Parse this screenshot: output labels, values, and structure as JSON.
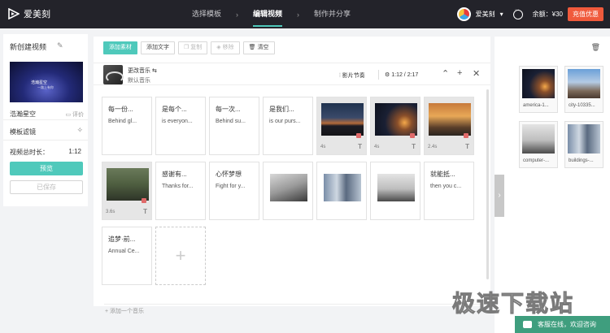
{
  "header": {
    "app_name": "爱美刻",
    "steps": [
      "选择模板",
      "编辑视频",
      "制作并分享"
    ],
    "active_step": 1,
    "chevron": "›",
    "user": "爱美刻",
    "user_caret": "▾",
    "balance": "余额：¥30",
    "promo": "充值优惠"
  },
  "left": {
    "project_title": "新创建视频",
    "pencil": "✎",
    "thumb_line1": "浩瀚星空",
    "thumb_line2": "一路上有你",
    "template_name": "浩瀚星空",
    "comment": "评价",
    "filter_label": "模板滤镜",
    "filter_icon": "✧",
    "duration_label": "视频总时长：",
    "duration_value": "1:12",
    "preview_btn": "预览",
    "saved_btn": "已保存"
  },
  "toolbar": {
    "add_material": "添加素材",
    "add_text": "添加文字",
    "copy": "复制",
    "remove": "移除",
    "clear": "清空"
  },
  "music": {
    "change": "更改音乐",
    "change_icon": "⇆",
    "default": "默认音乐",
    "rhythm": "影片节奏",
    "time": "1:12 / 2:17",
    "add_music": "+ 添加一个音乐"
  },
  "cards": [
    {
      "type": "text",
      "head": "每一份...",
      "sub": "Behind gl..."
    },
    {
      "type": "text",
      "head": "是每个...",
      "sub": "is everyon..."
    },
    {
      "type": "text",
      "head": "每一次...",
      "sub": "Behind su..."
    },
    {
      "type": "text",
      "head": "是我们...",
      "sub": "is our purs..."
    },
    {
      "type": "img",
      "dur": "4s",
      "tt": "T",
      "pic": "sunset"
    },
    {
      "type": "img",
      "dur": "4s",
      "tt": "T",
      "pic": "citynight"
    },
    {
      "type": "img",
      "dur": "2.4s",
      "tt": "T",
      "pic": "wind"
    },
    {
      "type": "img",
      "dur": "3.6s",
      "tt": "T",
      "pic": "office"
    },
    {
      "type": "text",
      "head": "感谢有...",
      "sub": "Thanks for..."
    },
    {
      "type": "text",
      "head": "心怀梦想",
      "sub": "Fight for y..."
    },
    {
      "type": "plain",
      "pic": "hands"
    },
    {
      "type": "plain",
      "pic": "buildings"
    },
    {
      "type": "plain",
      "pic": "laptop"
    },
    {
      "type": "text",
      "head": "就能抵...",
      "sub": "then you c..."
    },
    {
      "type": "text",
      "head": "追梦·前...",
      "sub": "Annual Ce..."
    },
    {
      "type": "add"
    }
  ],
  "assets": [
    {
      "name": "america-1...",
      "pic": "citynight"
    },
    {
      "name": "city-10335...",
      "pic": "citytower"
    },
    {
      "name": "computer-...",
      "pic": "laptop"
    },
    {
      "name": "buildings-...",
      "pic": "buildings"
    }
  ],
  "right": {
    "trash_icon": "🗑",
    "handle": "›"
  },
  "chat": "客服在线，欢迎咨询",
  "watermark": "极速下载站"
}
